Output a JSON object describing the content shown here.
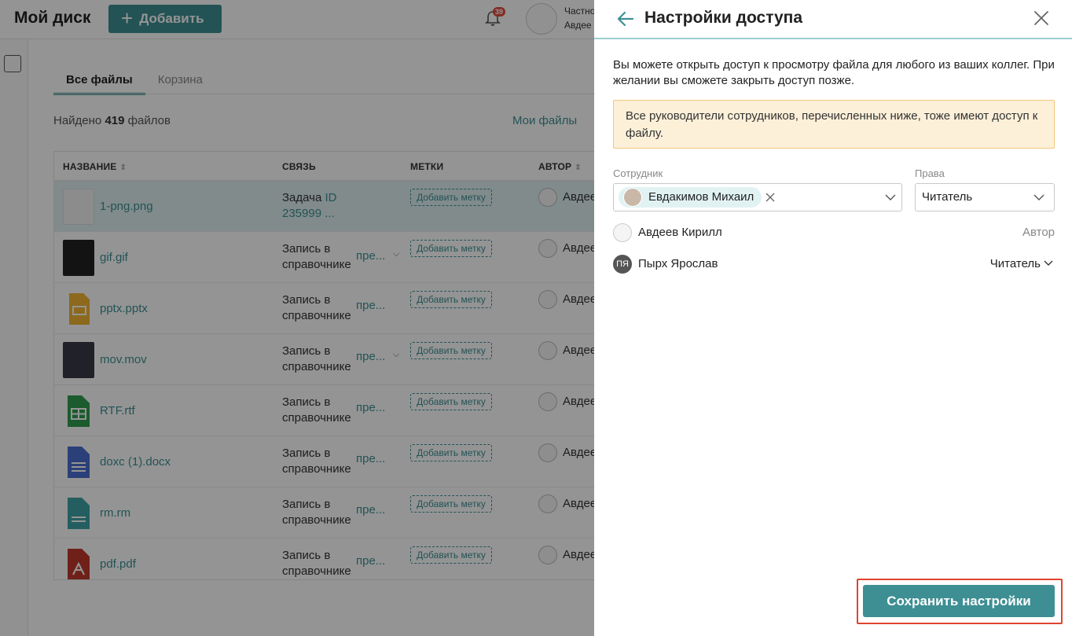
{
  "app": {
    "title": "Мой диск",
    "add_button": "Добавить",
    "notifications_count": "39",
    "user_line1": "Частно",
    "user_line2": "Авдее"
  },
  "tabs": [
    {
      "label": "Все файлы",
      "active": true
    },
    {
      "label": "Корзина",
      "active": false
    }
  ],
  "summary": {
    "prefix": "Найдено",
    "count": "419",
    "suffix": "файлов",
    "my_files_link": "Мои файлы"
  },
  "table": {
    "columns": [
      "НАЗВАНИЕ",
      "СВЯЗЬ",
      "МЕТКИ",
      "АВТОР"
    ],
    "rows": [
      {
        "name": "1-png.png",
        "link_text": "Задача",
        "link_value": "ID 235999 ...",
        "tag": "Добавить метку",
        "author": "Авдее",
        "icon": "image-thumbnail",
        "selected": true
      },
      {
        "name": "gif.gif",
        "link_text": "Запись в справочнике",
        "link_value": "пре...",
        "tag": "Добавить метку",
        "author": "Авдее",
        "icon": "gif-thumbnail",
        "chevron": true
      },
      {
        "name": "pptx.pptx",
        "link_text": "Запись в справочнике",
        "link_value": "пре...",
        "tag": "Добавить метку",
        "author": "Авдее",
        "icon": "presentation-icon"
      },
      {
        "name": "mov.mov",
        "link_text": "Запись в справочнике",
        "link_value": "пре...",
        "tag": "Добавить метку",
        "author": "Авдее",
        "icon": "video-thumbnail",
        "chevron": true
      },
      {
        "name": "RTF.rtf",
        "link_text": "Запись в справочнике",
        "link_value": "пре...",
        "tag": "Добавить метку",
        "author": "Авдее",
        "icon": "spreadsheet-icon"
      },
      {
        "name": "doxc (1).docx",
        "link_text": "Запись в справочнике",
        "link_value": "пре...",
        "tag": "Добавить метку",
        "author": "Авдее",
        "icon": "document-icon"
      },
      {
        "name": "rm.rm",
        "link_text": "Запись в справочнике",
        "link_value": "пре...",
        "tag": "Добавить метку",
        "author": "Авдее",
        "icon": "text-file-icon"
      },
      {
        "name": "pdf.pdf",
        "link_text": "Запись в справочнике",
        "link_value": "пре...",
        "tag": "Добавить метку",
        "author": "Авдее",
        "icon": "pdf-icon"
      }
    ]
  },
  "drawer": {
    "title": "Настройки доступа",
    "description": "Вы можете открыть доступ к просмотру файла для любого из ваших коллег. При желании вы сможете закрыть доступ позже.",
    "notice": "Все руководители сотрудников, перечисленных ниже, тоже имеют доступ к файлу.",
    "employee_label": "Сотрудник",
    "rights_label": "Права",
    "selected_employee": "Евдакимов Михаил",
    "selected_rights": "Читатель",
    "people": [
      {
        "name": "Авдеев Кирилл",
        "role": "Автор",
        "initials": ""
      },
      {
        "name": "Пырх Ярослав",
        "role": "Читатель",
        "initials": "ПЯ"
      }
    ],
    "save_button": "Сохранить настройки"
  },
  "colors": {
    "accent": "#3d8f93",
    "notice_bg": "#fdf0d9",
    "highlight": "#e0442e"
  }
}
